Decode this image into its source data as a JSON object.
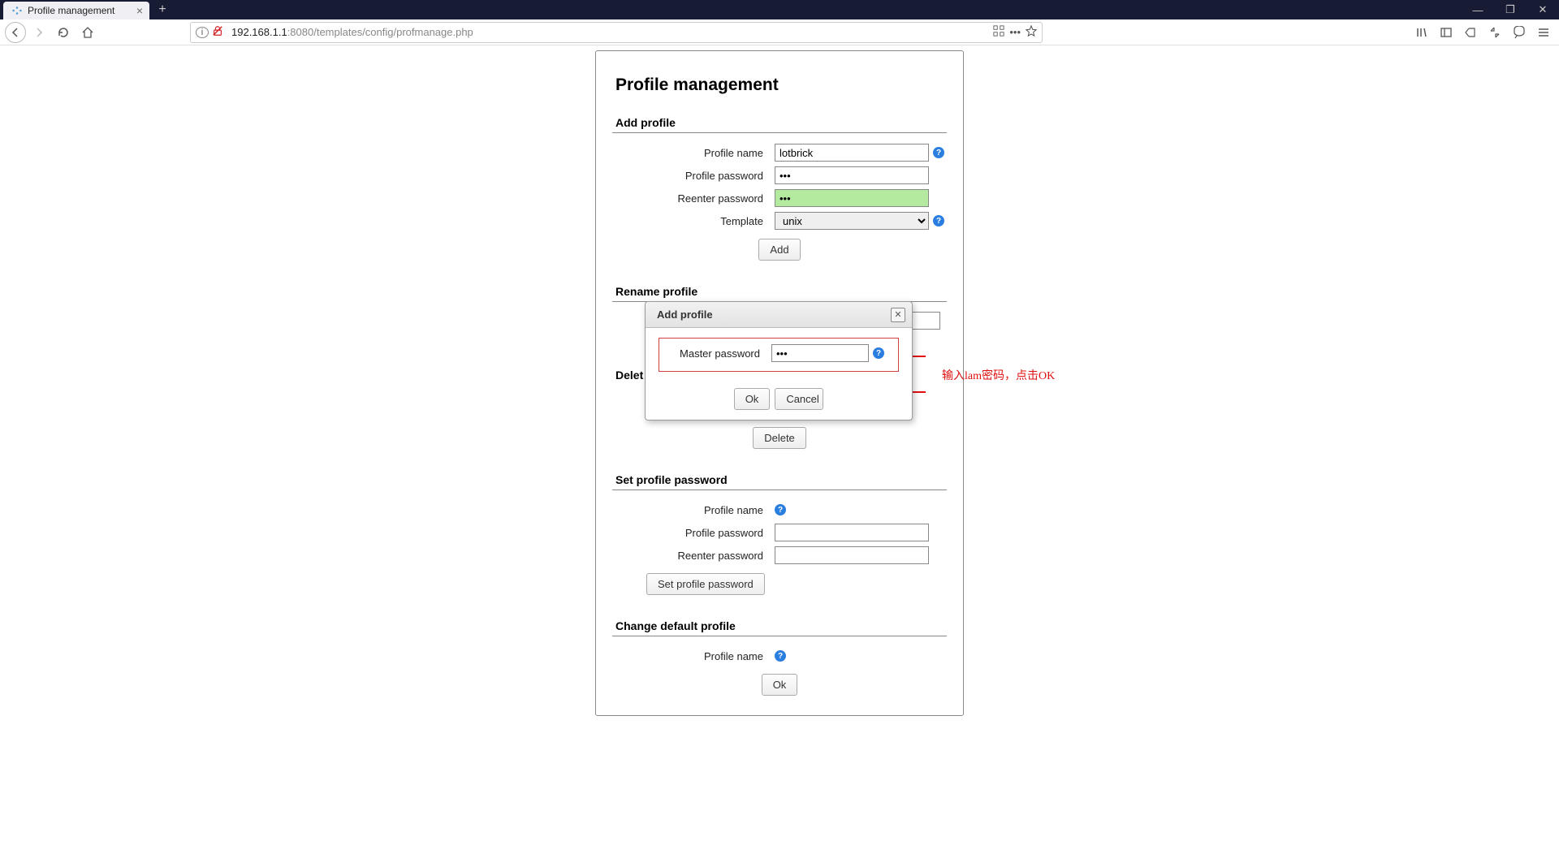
{
  "browser": {
    "tab_title": "Profile management",
    "url_host": "192.168.1.1",
    "url_rest": ":8080/templates/config/profmanage.php"
  },
  "page": {
    "title": "Profile management",
    "sections": {
      "add": {
        "heading": "Add profile",
        "labels": {
          "name": "Profile name",
          "password": "Profile password",
          "reenter": "Reenter password",
          "template": "Template"
        },
        "values": {
          "name": "lotbrick",
          "password": "•••",
          "reenter": "•••",
          "template": "unix"
        },
        "button": "Add"
      },
      "rename": {
        "heading": "Rename profile"
      },
      "delete": {
        "heading": "Delet",
        "button": "Delete"
      },
      "setpw": {
        "heading": "Set profile password",
        "labels": {
          "name": "Profile name",
          "password": "Profile password",
          "reenter": "Reenter password"
        },
        "button": "Set profile password"
      },
      "changedef": {
        "heading": "Change default profile",
        "labels": {
          "name": "Profile name"
        },
        "button": "Ok"
      }
    }
  },
  "modal": {
    "title": "Add profile",
    "label": "Master password",
    "value": "•••",
    "ok": "Ok",
    "cancel": "Cancel"
  },
  "annotation": {
    "text": "输入lam密码，点击OK"
  }
}
